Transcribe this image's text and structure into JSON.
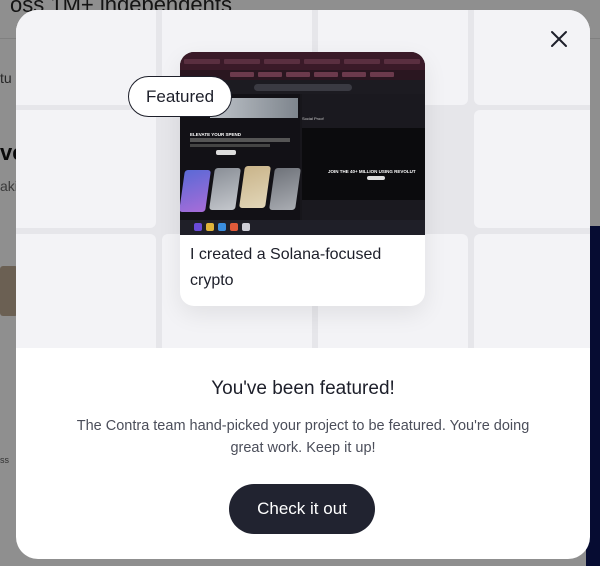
{
  "background": {
    "headline": "oss 1M+ independents",
    "fragment_a": "tu",
    "fragment_b": "ve",
    "fragment_c": "aki",
    "fragment_d": "ss"
  },
  "modal": {
    "close_icon": "close-icon",
    "badge_label": "Featured",
    "project_caption": "I created a Solana-focused crypto",
    "screenshot": {
      "hero_text": "ELEVATE YOUR SPEND",
      "right_header": "Social Proof",
      "right_text": "JOIN THE 40+ MILLION USING REVOLUT"
    },
    "title": "You've been featured!",
    "description": "The Contra team hand-picked your project to be featured. You're doing great work. Keep it up!",
    "cta_label": "Check it out"
  },
  "colors": {
    "button_bg": "#212330",
    "text_dark": "#1d1f2a",
    "text_muted": "#4b4e5a",
    "hero_bg": "#e6e6ea"
  }
}
